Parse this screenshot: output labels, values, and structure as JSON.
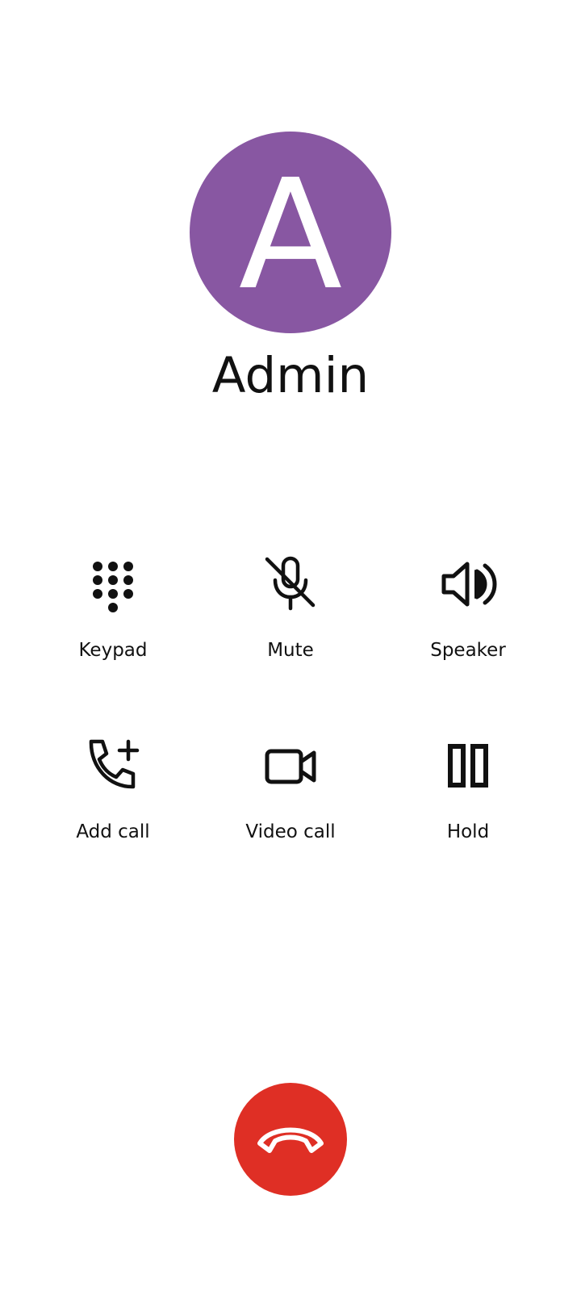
{
  "call": {
    "avatar_letter": "A",
    "contact_name": "Admin",
    "avatar_color": "#8857a2"
  },
  "controls": [
    {
      "label": "Keypad",
      "icon": "dialpad-icon"
    },
    {
      "label": "Mute",
      "icon": "mic-off-icon"
    },
    {
      "label": "Speaker",
      "icon": "speaker-icon"
    },
    {
      "label": "Add call",
      "icon": "add-call-icon"
    },
    {
      "label": "Video call",
      "icon": "video-camera-icon"
    },
    {
      "label": "Hold",
      "icon": "pause-icon"
    }
  ],
  "end_call": {
    "icon": "hang-up-phone-icon",
    "color": "#df2f25"
  }
}
